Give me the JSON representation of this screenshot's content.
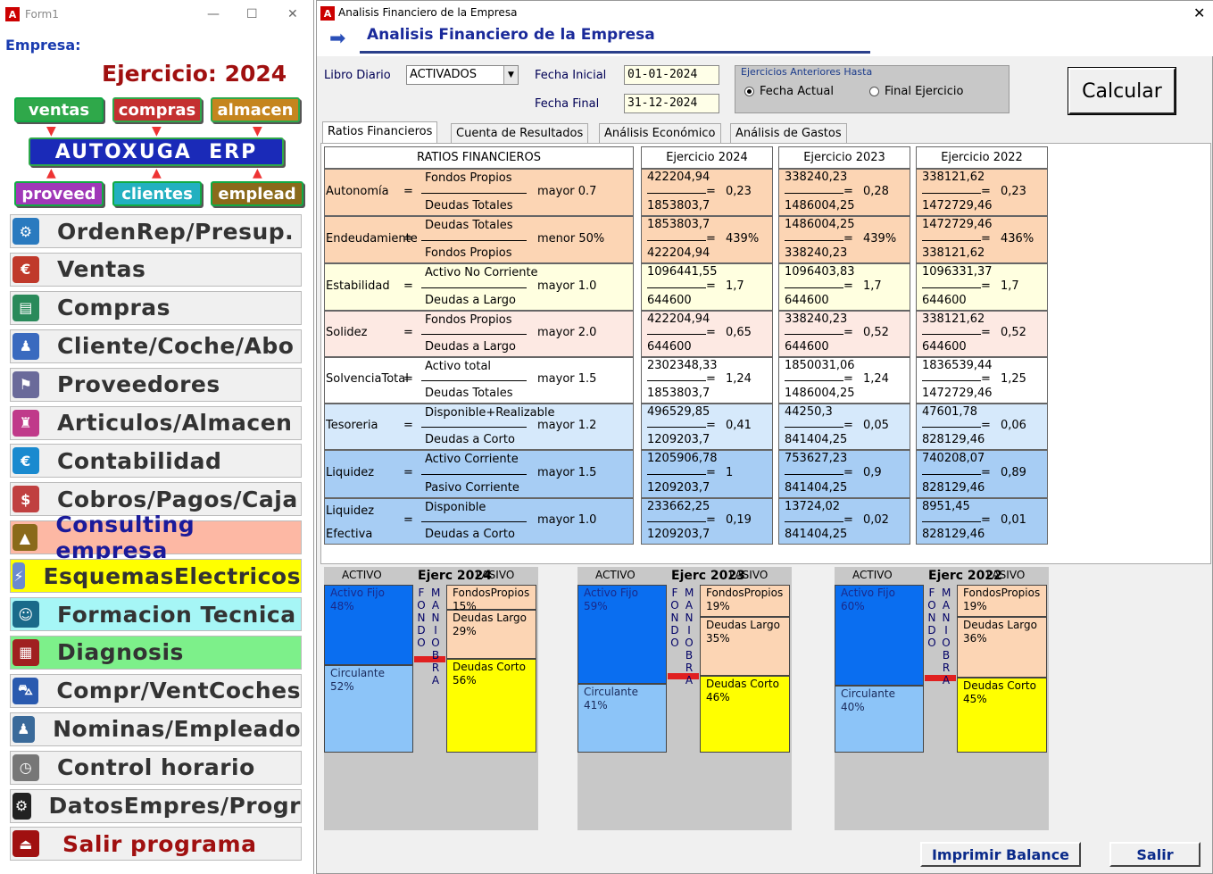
{
  "left_window": {
    "title": "Form1",
    "empresa_label": "Empresa:",
    "ejercicio": "Ejercicio: 2024",
    "tags": {
      "ventas": "ventas",
      "compras": "compras",
      "almacen": "almacen",
      "erp": "AUTOXUGA  ERP",
      "proveed": "proveed",
      "clientes": "clientes",
      "emplead": "emplead"
    },
    "menu": [
      {
        "label": "OrdenRep/Presup.",
        "icon": "repair-order-icon",
        "bg": "#f0f0f0"
      },
      {
        "label": "Ventas",
        "icon": "sales-chart-icon",
        "bg": "#f0f0f0"
      },
      {
        "label": "Compras",
        "icon": "purchases-icon",
        "bg": "#f0f0f0"
      },
      {
        "label": "Cliente/Coche/Abo",
        "icon": "clients-icon",
        "bg": "#f0f0f0"
      },
      {
        "label": "Proveedores",
        "icon": "suppliers-icon",
        "bg": "#f0f0f0"
      },
      {
        "label": "Articulos/Almacen",
        "icon": "warehouse-icon",
        "bg": "#f0f0f0"
      },
      {
        "label": "Contabilidad",
        "icon": "accounting-icon",
        "bg": "#f0f0f0"
      },
      {
        "label": "Cobros/Pagos/Caja",
        "icon": "cash-icon",
        "bg": "#f0f0f0"
      },
      {
        "label": "Consulting empresa",
        "icon": "consulting-icon",
        "bg": "#fdb8a4"
      },
      {
        "label": "EsquemasElectricos",
        "icon": "electrical-schema-icon",
        "bg": "#ffff00"
      },
      {
        "label": "Formacion Tecnica",
        "icon": "graduate-icon",
        "bg": "#a6f6f6"
      },
      {
        "label": "Diagnosis",
        "icon": "diagnosis-icon",
        "bg": "#7df08a"
      },
      {
        "label": "Compr/VentCoches",
        "icon": "car-icon",
        "bg": "#f0f0f0"
      },
      {
        "label": "Nominas/Empleado",
        "icon": "payroll-icon",
        "bg": "#f0f0f0"
      },
      {
        "label": "Control horario",
        "icon": "clock-icon",
        "bg": "#f0f0f0"
      },
      {
        "label": "DatosEmpres/Progr",
        "icon": "gear-icon",
        "bg": "#f0f0f0"
      },
      {
        "label": "Salir programa",
        "icon": "exit-icon",
        "bg": "#f0f0f0"
      }
    ]
  },
  "right_window": {
    "title": "Analisis Financiero de la Empresa",
    "header": "Analisis Financiero de la Empresa",
    "libro_label": "Libro Diario",
    "libro_value": "ACTIVADOS",
    "fecha_inicial_label": "Fecha Inicial",
    "fecha_inicial": "01-01-2024",
    "fecha_final_label": "Fecha Final",
    "fecha_final": "31-12-2024",
    "group_title": "Ejercicios Anteriores Hasta",
    "radio1": "Fecha Actual",
    "radio2": "Final Ejercicio",
    "calcular": "Calcular",
    "tabs": [
      "Ratios Financieros",
      "Cuenta de Resultados",
      "Análisis Económico",
      "Análisis de Gastos"
    ],
    "table": {
      "header": "RATIOS FINANCIEROS",
      "years": [
        "Ejercicio 2024",
        "Ejercicio 2023",
        "Ejercicio 2022"
      ],
      "rows": [
        {
          "name": "Autonomía",
          "num": "Fondos Propios",
          "den": "Deudas Totales",
          "cond": "mayor 0.7",
          "bg": "#fcd5b4",
          "vals": [
            [
              "422204,94",
              "1853803,7",
              "0,23"
            ],
            [
              "338240,23",
              "1486004,25",
              "0,28"
            ],
            [
              "338121,62",
              "1472729,46",
              "0,23"
            ]
          ]
        },
        {
          "name": "Endeudamiente",
          "num": "Deudas Totales",
          "den": "Fondos Propios",
          "cond": "menor 50%",
          "bg": "#fcd5b4",
          "vals": [
            [
              "1853803,7",
              "422204,94",
              "439%"
            ],
            [
              "1486004,25",
              "338240,23",
              "439%"
            ],
            [
              "1472729,46",
              "338121,62",
              "436%"
            ]
          ]
        },
        {
          "name": "Estabilidad",
          "num": "Activo No Corriente",
          "den": "Deudas a Largo",
          "cond": "mayor 1.0",
          "bg": "#ffffe0",
          "vals": [
            [
              "1096441,55",
              "644600",
              "1,7"
            ],
            [
              "1096403,83",
              "644600",
              "1,7"
            ],
            [
              "1096331,37",
              "644600",
              "1,7"
            ]
          ]
        },
        {
          "name": "Solidez",
          "num": "Fondos Propios",
          "den": "Deudas a Largo",
          "cond": "mayor 2.0",
          "bg": "#fde9e3",
          "vals": [
            [
              "422204,94",
              "644600",
              "0,65"
            ],
            [
              "338240,23",
              "644600",
              "0,52"
            ],
            [
              "338121,62",
              "644600",
              "0,52"
            ]
          ]
        },
        {
          "name": "SolvenciaTotal",
          "num": "Activo total",
          "den": "Deudas Totales",
          "cond": "mayor 1.5",
          "bg": "#ffffff",
          "vals": [
            [
              "2302348,33",
              "1853803,7",
              "1,24"
            ],
            [
              "1850031,06",
              "1486004,25",
              "1,24"
            ],
            [
              "1836539,44",
              "1472729,46",
              "1,25"
            ]
          ]
        },
        {
          "name": "Tesoreria",
          "num": "Disponible+Realizable",
          "den": "Deudas a Corto",
          "cond": "mayor 1.2",
          "bg": "#d6e9fb",
          "vals": [
            [
              "496529,85",
              "1209203,7",
              "0,41"
            ],
            [
              "44250,3",
              "841404,25",
              "0,05"
            ],
            [
              "47601,78",
              "828129,46",
              "0,06"
            ]
          ]
        },
        {
          "name": "Liquidez",
          "num": "Activo Corriente",
          "den": "Pasivo Corriente",
          "cond": "mayor 1.5",
          "bg": "#a7cdf4",
          "vals": [
            [
              "1205906,78",
              "1209203,7",
              "1"
            ],
            [
              "753627,23",
              "841404,25",
              "0,9"
            ],
            [
              "740208,07",
              "828129,46",
              "0,89"
            ]
          ]
        },
        {
          "name": "Liquidez",
          "name2": "Efectiva",
          "num": "Disponible",
          "den": "Deudas a Corto",
          "cond": "mayor 1.0",
          "bg": "#a7cdf4",
          "vals": [
            [
              "233662,25",
              "1209203,7",
              "0,19"
            ],
            [
              "13724,02",
              "841404,25",
              "0,02"
            ],
            [
              "8951,45",
              "828129,46",
              "0,01"
            ]
          ]
        }
      ]
    },
    "balances": [
      {
        "activo": "ACTIVO",
        "title": "Ejerc 2024",
        "pasivo": "PASIVO",
        "fijo": "Activo Fijo",
        "fijo_pct": "48%",
        "circ": "Circulante",
        "circ_pct": "52%",
        "fp": "FondosPropios",
        "fp_pct": "15%",
        "dl": "Deudas Largo",
        "dl_pct": "29%",
        "dc": "Deudas Corto",
        "dc_pct": "56%"
      },
      {
        "activo": "ACTIVO",
        "title": "Ejerc 2023",
        "pasivo": "PASIVO",
        "fijo": "Activo Fijo",
        "fijo_pct": "59%",
        "circ": "Circulante",
        "circ_pct": "41%",
        "fp": "FondosPropios",
        "fp_pct": "19%",
        "dl": "Deudas Largo",
        "dl_pct": "35%",
        "dc": "Deudas Corto",
        "dc_pct": "46%"
      },
      {
        "activo": "ACTIVO",
        "title": "Ejerc 2022",
        "pasivo": "PASIVO",
        "fijo": "Activo Fijo",
        "fijo_pct": "60%",
        "circ": "Circulante",
        "circ_pct": "40%",
        "fp": "FondosPropios",
        "fp_pct": "19%",
        "dl": "Deudas Largo",
        "dl_pct": "36%",
        "dc": "Deudas Corto",
        "dc_pct": "45%"
      }
    ],
    "fondo_letters": [
      "F",
      "O",
      "N",
      "D",
      "O"
    ],
    "maniobra_letters": [
      "M",
      "A",
      "N",
      "I",
      "O",
      "B",
      "R",
      "A"
    ],
    "imprimir": "Imprimir Balance",
    "salir": "Salir"
  }
}
